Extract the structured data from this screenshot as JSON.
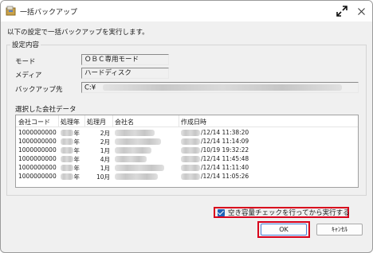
{
  "window": {
    "title": "一括バックアップ",
    "app_icon": "app-icon",
    "expand_icon": "expand-icon",
    "close_icon": "close-icon"
  },
  "intro": "以下の設定で一括バックアップを実行します。",
  "settings": {
    "label": "設定内容",
    "mode": {
      "label": "モード",
      "value": "ＯＢＣ専用モード"
    },
    "media": {
      "label": "メディア",
      "value": "ハードディスク"
    },
    "destination": {
      "label": "バックアップ先",
      "value": "C:¥"
    }
  },
  "company_data": {
    "label": "選択した会社データ",
    "headers": [
      "会社コード",
      "処理年",
      "処理月",
      "会社名",
      "作成日時"
    ],
    "rows": [
      {
        "code": "1000000000",
        "year": "年",
        "month": "2月",
        "date": "/12/14 11:38:20"
      },
      {
        "code": "1000000000",
        "year": "年",
        "month": "2月",
        "date": "/12/14 11:14:09"
      },
      {
        "code": "1000000000",
        "year": "年",
        "month": "1月",
        "date": "/10/19 19:32:22"
      },
      {
        "code": "1000000000",
        "year": "年",
        "month": "4月",
        "date": "/12/14 11:45:48"
      },
      {
        "code": "1000000000",
        "year": "年",
        "month": "1月",
        "date": "/12/14 11:11:40"
      },
      {
        "code": "1000000000",
        "year": "年",
        "month": "10月",
        "date": "/12/14 11:05:26"
      }
    ]
  },
  "capacity_check": {
    "label": "空き容量チェックを行ってから実行する",
    "checked": true
  },
  "buttons": {
    "ok": "OK",
    "cancel": "ｷｬﾝｾﾙ"
  },
  "colors": {
    "highlight": "#d8001c",
    "checkbox": "#1f62b8"
  }
}
